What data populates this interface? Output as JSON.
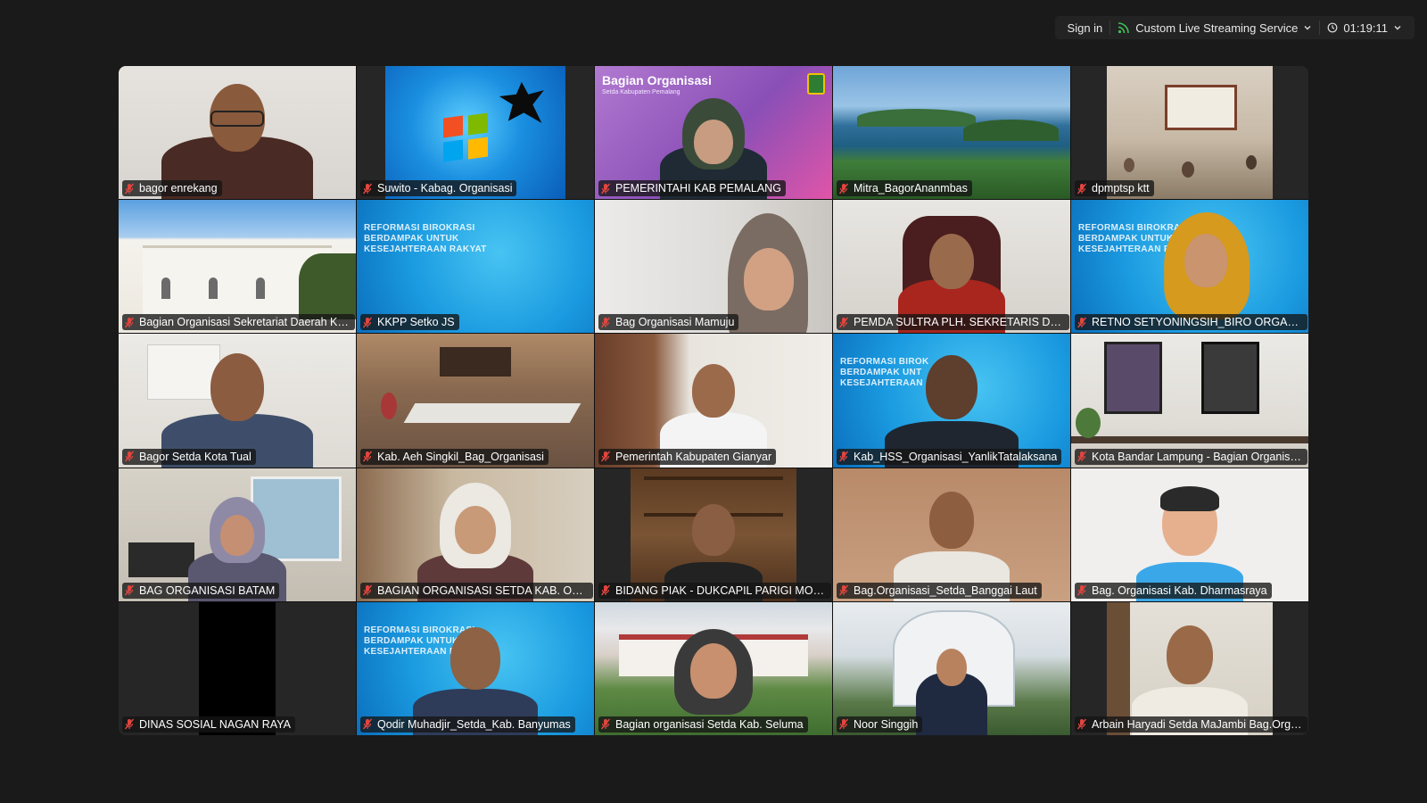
{
  "topbar": {
    "sign_in": "Sign in",
    "streaming": "Custom Live Streaming Service",
    "timer": "01:19:11"
  },
  "participants": [
    {
      "name": "bagor enrekang",
      "muted": true
    },
    {
      "name": "Suwito - Kabag. Organisasi",
      "muted": true
    },
    {
      "name": "PEMERINTAHI KAB PEMALANG",
      "muted": true,
      "banner": "Bagian Organisasi",
      "banner_sub": "Setda Kabupaten Pemalang"
    },
    {
      "name": "Mitra_BagorAnanmbas",
      "muted": true
    },
    {
      "name": "dpmptsp ktt",
      "muted": true
    },
    {
      "name": "Bagian Organisasi Sekretariat Daerah Kabupaten",
      "muted": true
    },
    {
      "name": "KKPP Setko JS",
      "muted": true,
      "banner": "REFORMASI BIROKRASI\nBERDAMPAK UNTUK\nKESEJAHTERAAN RAKYAT"
    },
    {
      "name": "Bag Organisasi Mamuju",
      "muted": true
    },
    {
      "name": "PEMDA SULTRA PLH. SEKRETARIS DAERAH",
      "muted": true
    },
    {
      "name": "RETNO SETYONINGSIH_BIRO ORGANISASI",
      "muted": true,
      "banner": "REFORMASI BIROKRA\nBERDAMPAK UNTUK\nKESEJAHTERAAN RA"
    },
    {
      "name": "Bagor Setda Kota Tual",
      "muted": true
    },
    {
      "name": "Kab. Aeh Singkil_Bag_Organisasi",
      "muted": true
    },
    {
      "name": "Pemerintah Kabupaten Gianyar",
      "muted": true
    },
    {
      "name": "Kab_HSS_Organisasi_YanlikTatalaksana",
      "muted": true,
      "banner": "REFORMASI BIROK\nBERDAMPAK UNT\nKESEJAHTERAAN"
    },
    {
      "name": "Kota Bandar Lampung - Bagian Organisasi",
      "muted": true
    },
    {
      "name": "BAG ORGANISASI BATAM",
      "muted": true
    },
    {
      "name": "BAGIAN ORGANISASI SETDA KAB. OKU TIMUR",
      "muted": true
    },
    {
      "name": "BIDANG PIAK - DUKCAPIL PARIGI MOUTONG",
      "muted": true
    },
    {
      "name": "Bag.Organisasi_Setda_Banggai Laut",
      "muted": true
    },
    {
      "name": "Bag. Organisasi Kab. Dharmasraya",
      "muted": true
    },
    {
      "name": "DINAS SOSIAL NAGAN RAYA",
      "muted": true
    },
    {
      "name": "Qodir Muhadjir_Setda_Kab. Banyumas",
      "muted": true,
      "banner": "REFORMASI BIROKRASI\nBERDAMPAK UNTUK\nKESEJAHTERAAN RAKYAT"
    },
    {
      "name": "Bagian organisasi Setda Kab. Seluma",
      "muted": true
    },
    {
      "name": "Noor Singgih",
      "muted": true
    },
    {
      "name": "Arbain Haryadi Setda MaJambi Bag.Organisasi",
      "muted": true
    }
  ],
  "colors": {
    "background": "#1a1a1a",
    "mic_muted": "#e0463f",
    "nameplate": "#141414"
  }
}
